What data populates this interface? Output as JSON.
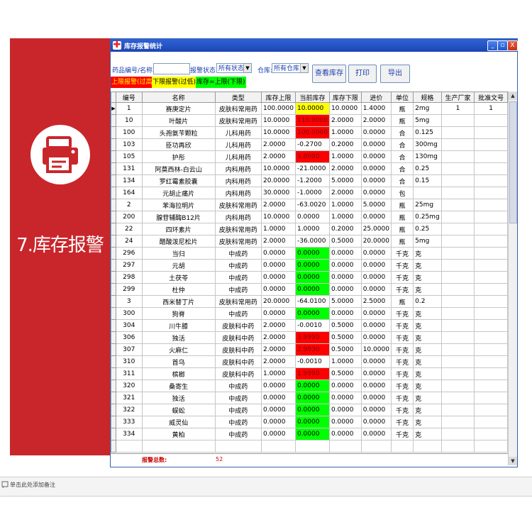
{
  "slide": {
    "title": "7.库存报警",
    "note": "单击此处添加备注"
  },
  "window": {
    "title": "库存报警统计",
    "controls": {
      "minimize": "_",
      "maximize": "▫",
      "close": "X"
    }
  },
  "filters": {
    "drug_label": "药品编号/名称:",
    "drug_value": "",
    "status_label": "报警状态:",
    "status_value": "所有状态",
    "warehouse_label": "仓库:",
    "warehouse_value": "所有仓库"
  },
  "buttons": {
    "view_stock": "查看库存",
    "print": "打印",
    "export": "导出"
  },
  "legend": {
    "upper": "上限报警(过高)",
    "lower": "下限报警(过低)",
    "equal": "库存=上限(下限)"
  },
  "colors": {
    "upper": "#ff0000",
    "lower": "#ffff00",
    "equal": "#00ff00",
    "none": "#ffffff",
    "legend_upper_text": "#ffff00",
    "legend_lower_text": "#000000"
  },
  "table": {
    "columns": [
      "编号",
      "名称",
      "类型",
      "库存上限",
      "当前库存",
      "库存下限",
      "进价",
      "单位",
      "规格",
      "生产厂家",
      "批准文号"
    ],
    "rows": [
      {
        "id": "1",
        "name": "赛庚定片",
        "type": "皮肤科常用药",
        "upper": "100.0000",
        "current": "10.0000",
        "lower": "10.0000",
        "price": "1.4000",
        "unit": "瓶",
        "spec": "2mg",
        "maker": "1",
        "approval": "1",
        "alert": "lower"
      },
      {
        "id": "10",
        "name": "叶酸片",
        "type": "皮肤科常用药",
        "upper": "10.0000",
        "current": "110.0000",
        "lower": "2.0000",
        "price": "2.0000",
        "unit": "瓶",
        "spec": "5mg",
        "maker": "",
        "approval": "",
        "alert": "upper"
      },
      {
        "id": "100",
        "name": "头孢氨苄颗粒",
        "type": "儿科用药",
        "upper": "10.0000",
        "current": "100.0000",
        "lower": "1.0000",
        "price": "0.0000",
        "unit": "合",
        "spec": "0.125",
        "maker": "",
        "approval": "",
        "alert": "upper"
      },
      {
        "id": "103",
        "name": "臣功再欣",
        "type": "儿科用药",
        "upper": "2.0000",
        "current": "-0.2700",
        "lower": "0.2000",
        "price": "0.0000",
        "unit": "合",
        "spec": "300mg",
        "maker": "",
        "approval": "",
        "alert": "none"
      },
      {
        "id": "105",
        "name": "护彤",
        "type": "儿科用药",
        "upper": "2.0000",
        "current": "9.8000",
        "lower": "1.0000",
        "price": "0.0000",
        "unit": "合",
        "spec": "130mg",
        "maker": "",
        "approval": "",
        "alert": "upper"
      },
      {
        "id": "131",
        "name": "阿莫西林-白云山",
        "type": "内科用药",
        "upper": "10.0000",
        "current": "-21.0000",
        "lower": "2.0000",
        "price": "0.0000",
        "unit": "合",
        "spec": "0.25",
        "maker": "",
        "approval": "",
        "alert": "none"
      },
      {
        "id": "134",
        "name": "罗红霉素胶囊",
        "type": "内科用药",
        "upper": "20.0000",
        "current": "-1.2000",
        "lower": "5.0000",
        "price": "0.0000",
        "unit": "合",
        "spec": "0.15",
        "maker": "",
        "approval": "",
        "alert": "none"
      },
      {
        "id": "164",
        "name": "元胡止痛片",
        "type": "内科用药",
        "upper": "30.0000",
        "current": "-1.0000",
        "lower": "2.0000",
        "price": "0.0000",
        "unit": "包",
        "spec": "",
        "maker": "",
        "approval": "",
        "alert": "none"
      },
      {
        "id": "2",
        "name": "苯海拉明片",
        "type": "皮肤科常用药",
        "upper": "2.0000",
        "current": "-63.0020",
        "lower": "1.0000",
        "price": "5.0000",
        "unit": "瓶",
        "spec": "25mg",
        "maker": "",
        "approval": "",
        "alert": "none"
      },
      {
        "id": "200",
        "name": "腺苷辅酶B12片",
        "type": "内科用药",
        "upper": "10.0000",
        "current": "0.0000",
        "lower": "1.0000",
        "price": "0.0000",
        "unit": "瓶",
        "spec": "0.25mg",
        "maker": "",
        "approval": "",
        "alert": "none"
      },
      {
        "id": "22",
        "name": "四环素片",
        "type": "皮肤科常用药",
        "upper": "1.0000",
        "current": "1.0000",
        "lower": "0.2000",
        "price": "25.0000",
        "unit": "瓶",
        "spec": "0.25",
        "maker": "",
        "approval": "",
        "alert": "none"
      },
      {
        "id": "24",
        "name": "醋酸泼尼松片",
        "type": "皮肤科常用药",
        "upper": "2.0000",
        "current": "-36.0000",
        "lower": "0.5000",
        "price": "20.0000",
        "unit": "瓶",
        "spec": "5mg",
        "maker": "",
        "approval": "",
        "alert": "none"
      },
      {
        "id": "296",
        "name": "当归",
        "type": "中成药",
        "upper": "0.0000",
        "current": "0.0000",
        "lower": "0.0000",
        "price": "0.0000",
        "unit": "千克",
        "spec": "克",
        "maker": "",
        "approval": "",
        "alert": "equal"
      },
      {
        "id": "297",
        "name": "元胡",
        "type": "中成药",
        "upper": "0.0000",
        "current": "0.0000",
        "lower": "0.0000",
        "price": "0.0000",
        "unit": "千克",
        "spec": "克",
        "maker": "",
        "approval": "",
        "alert": "equal"
      },
      {
        "id": "298",
        "name": "土茯苓",
        "type": "中成药",
        "upper": "0.0000",
        "current": "0.0000",
        "lower": "0.0000",
        "price": "0.0000",
        "unit": "千克",
        "spec": "克",
        "maker": "",
        "approval": "",
        "alert": "equal"
      },
      {
        "id": "299",
        "name": "杜仲",
        "type": "中成药",
        "upper": "0.0000",
        "current": "0.0000",
        "lower": "0.0000",
        "price": "0.0000",
        "unit": "千克",
        "spec": "克",
        "maker": "",
        "approval": "",
        "alert": "equal"
      },
      {
        "id": "3",
        "name": "西米替丁片",
        "type": "皮肤科常用药",
        "upper": "20.0000",
        "current": "-64.0100",
        "lower": "5.0000",
        "price": "2.5000",
        "unit": "瓶",
        "spec": "0.2",
        "maker": "",
        "approval": "",
        "alert": "none"
      },
      {
        "id": "300",
        "name": "狗脊",
        "type": "中成药",
        "upper": "0.0000",
        "current": "0.0000",
        "lower": "0.0000",
        "price": "0.0000",
        "unit": "千克",
        "spec": "克",
        "maker": "",
        "approval": "",
        "alert": "equal"
      },
      {
        "id": "304",
        "name": "川牛膝",
        "type": "皮肤科中药",
        "upper": "2.0000",
        "current": "-0.0010",
        "lower": "0.5000",
        "price": "0.0000",
        "unit": "千克",
        "spec": "克",
        "maker": "",
        "approval": "",
        "alert": "none"
      },
      {
        "id": "306",
        "name": "独活",
        "type": "皮肤科中药",
        "upper": "2.0000",
        "current": "3.9990",
        "lower": "0.5000",
        "price": "0.0000",
        "unit": "千克",
        "spec": "克",
        "maker": "",
        "approval": "",
        "alert": "upper"
      },
      {
        "id": "307",
        "name": "火麻仁",
        "type": "皮肤科中药",
        "upper": "2.0000",
        "current": "2.9930",
        "lower": "0.5000",
        "price": "10.0000",
        "unit": "千克",
        "spec": "克",
        "maker": "",
        "approval": "",
        "alert": "upper"
      },
      {
        "id": "310",
        "name": "首乌",
        "type": "皮肤科中药",
        "upper": "2.0000",
        "current": "-0.0010",
        "lower": "1.0000",
        "price": "0.0000",
        "unit": "千克",
        "spec": "克",
        "maker": "",
        "approval": "",
        "alert": "none"
      },
      {
        "id": "311",
        "name": "槟榔",
        "type": "皮肤科中药",
        "upper": "1.0000",
        "current": "1.9990",
        "lower": "0.5000",
        "price": "0.0000",
        "unit": "千克",
        "spec": "克",
        "maker": "",
        "approval": "",
        "alert": "upper"
      },
      {
        "id": "320",
        "name": "桑寄生",
        "type": "中成药",
        "upper": "0.0000",
        "current": "0.0000",
        "lower": "0.0000",
        "price": "0.0000",
        "unit": "千克",
        "spec": "克",
        "maker": "",
        "approval": "",
        "alert": "equal"
      },
      {
        "id": "321",
        "name": "独活",
        "type": "中成药",
        "upper": "0.0000",
        "current": "0.0000",
        "lower": "0.0000",
        "price": "0.0000",
        "unit": "千克",
        "spec": "克",
        "maker": "",
        "approval": "",
        "alert": "equal"
      },
      {
        "id": "322",
        "name": "蜈蚣",
        "type": "中成药",
        "upper": "0.0000",
        "current": "0.0000",
        "lower": "0.0000",
        "price": "0.0000",
        "unit": "千克",
        "spec": "克",
        "maker": "",
        "approval": "",
        "alert": "equal"
      },
      {
        "id": "333",
        "name": "威灵仙",
        "type": "中成药",
        "upper": "0.0000",
        "current": "0.0000",
        "lower": "0.0000",
        "price": "0.0000",
        "unit": "千克",
        "spec": "克",
        "maker": "",
        "approval": "",
        "alert": "equal"
      },
      {
        "id": "334",
        "name": "黄柏",
        "type": "中成药",
        "upper": "0.0000",
        "current": "0.0000",
        "lower": "0.0000",
        "price": "0.0000",
        "unit": "千克",
        "spec": "克",
        "maker": "",
        "approval": "",
        "alert": "equal"
      }
    ]
  },
  "summary": {
    "label": "报警总数:",
    "value": "52"
  }
}
